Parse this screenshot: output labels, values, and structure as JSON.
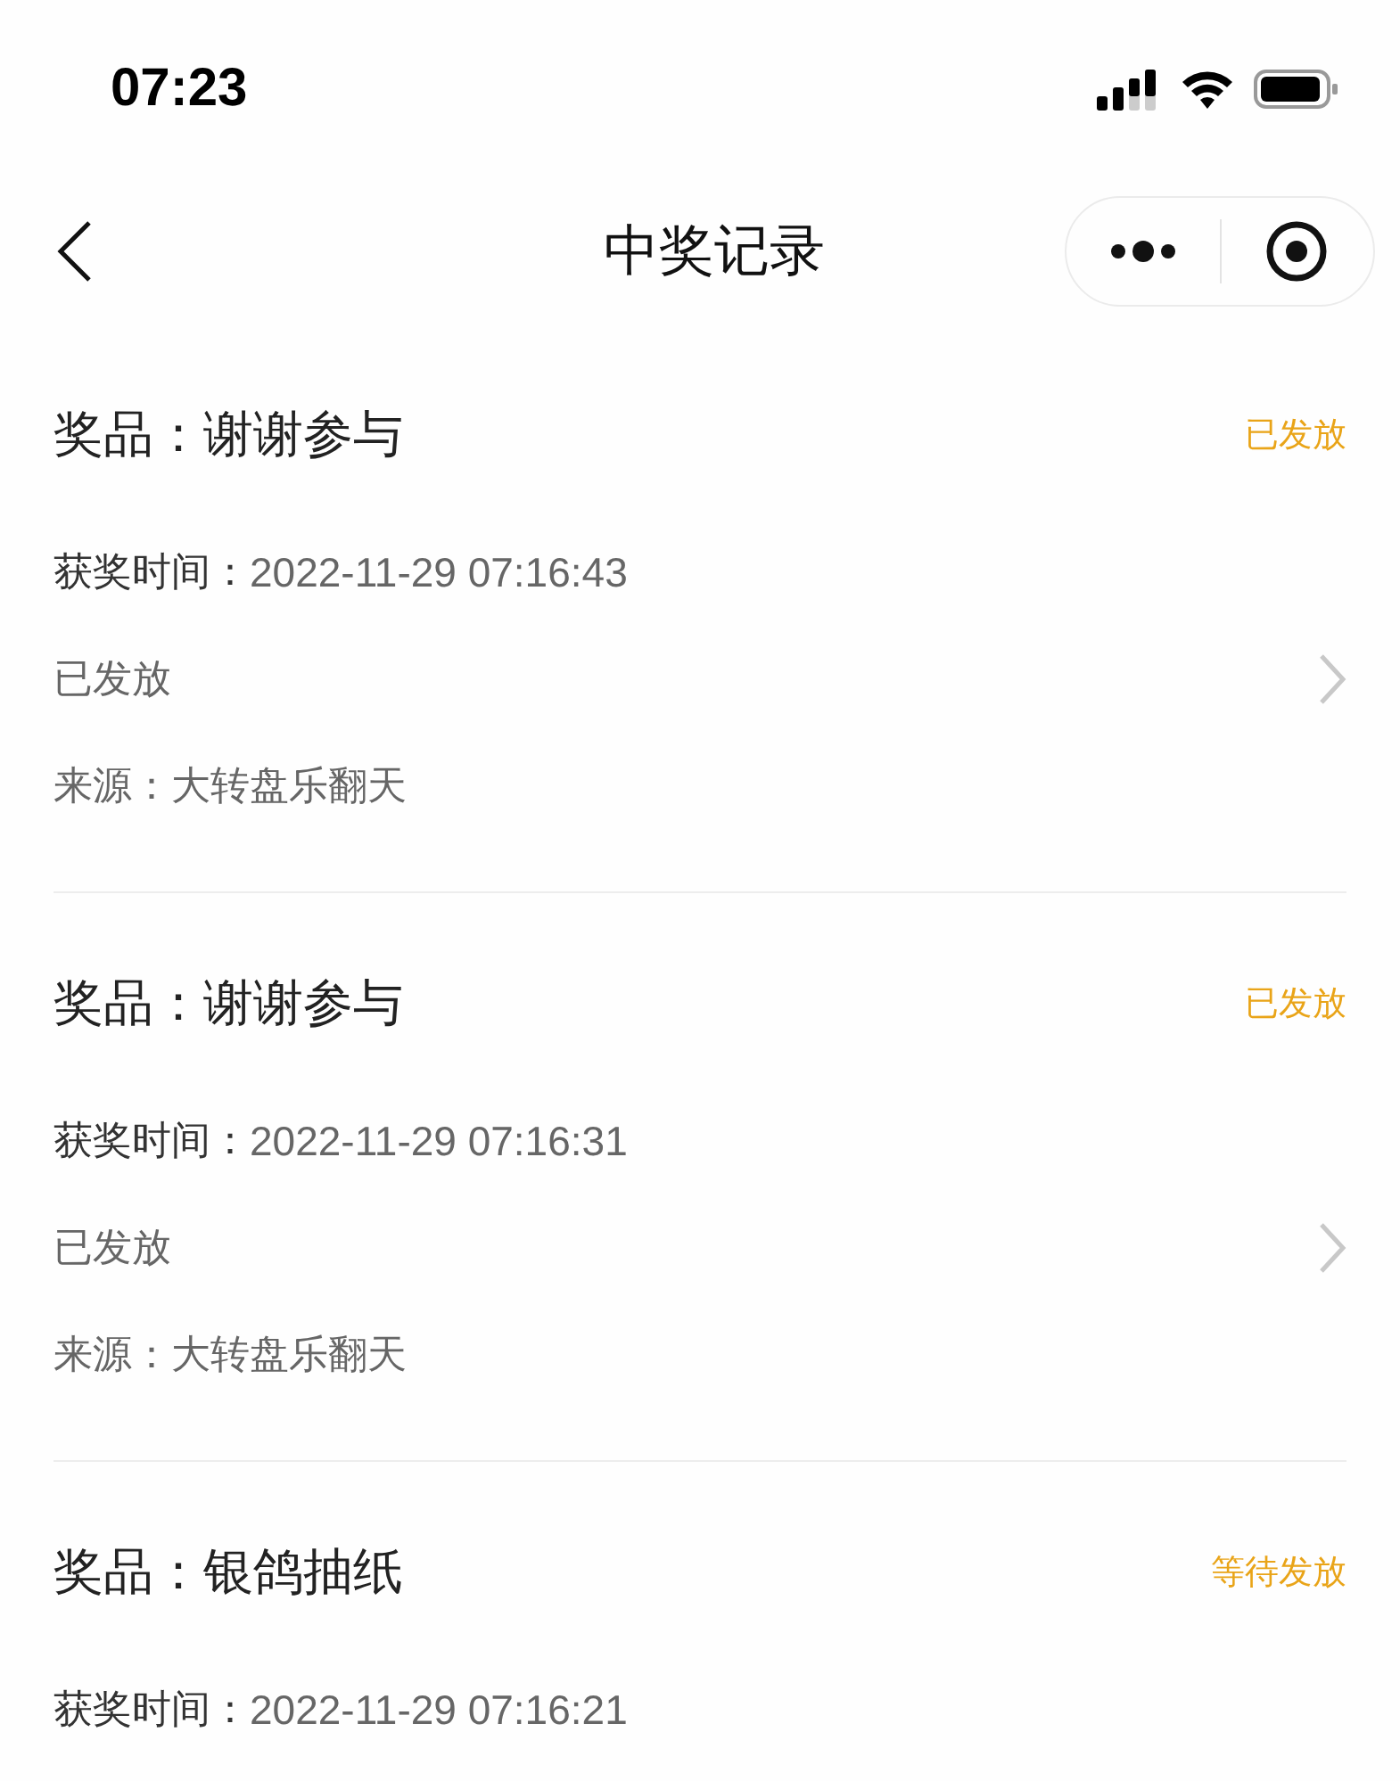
{
  "status_bar": {
    "time": "07:23"
  },
  "nav": {
    "title": "中奖记录"
  },
  "records": [
    {
      "prize": "奖品：谢谢参与",
      "badge": "已发放",
      "time_label": "获奖时间：",
      "time": "2022-11-29 07:16:43",
      "status": "已发放",
      "source": "来源：大转盘乐翻天"
    },
    {
      "prize": "奖品：谢谢参与",
      "badge": "已发放",
      "time_label": "获奖时间：",
      "time": "2022-11-29 07:16:31",
      "status": "已发放",
      "source": "来源：大转盘乐翻天"
    },
    {
      "prize": "奖品：银鸽抽纸",
      "badge": "等待发放",
      "time_label": "获奖时间：",
      "time": "2022-11-29 07:16:21"
    }
  ]
}
